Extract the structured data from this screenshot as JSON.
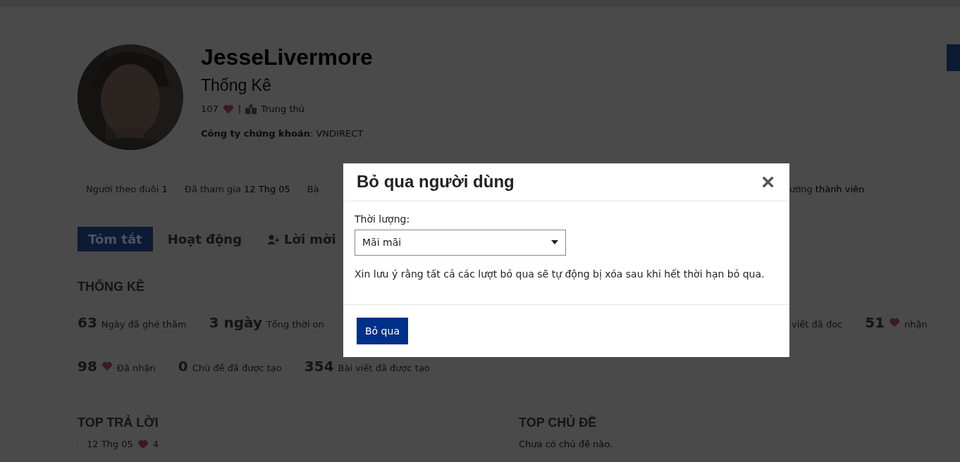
{
  "profile": {
    "name": "JesseLivermore",
    "subtitle": "Thống Kê",
    "reactions": "107",
    "separator": "|",
    "rank": "Trung thủ",
    "broker": "**Công ty chứng khoán**: VNDIRECT"
  },
  "meta": {
    "left": [
      {
        "label": "Người theo đuôi",
        "value": "1"
      },
      {
        "label": "Đã tham gia",
        "value": "12 Thg 05"
      },
      {
        "label": "Bà"
      }
    ],
    "right": [
      {
        "label": "ường",
        "value": "thành viên"
      }
    ]
  },
  "tabs": [
    {
      "label": "Tóm tắt",
      "selected": true,
      "kind": "plain"
    },
    {
      "label": "Hoạt động",
      "selected": false,
      "kind": "plain"
    },
    {
      "label": "Lời mời",
      "selected": false,
      "kind": "invite"
    }
  ],
  "stats": {
    "title": "THỐNG KÊ",
    "rows": [
      {
        "left": [
          {
            "kind": "plain",
            "value": "63",
            "label": "Ngày đã ghé thăm"
          },
          {
            "kind": "plain",
            "value": "3 ngày",
            "label": "Tổng thời on"
          }
        ],
        "right": [
          {
            "kind": "label_only",
            "label": "viết đã đọc"
          },
          {
            "kind": "heart",
            "value": "51",
            "label": "nhận"
          }
        ]
      },
      {
        "left": [
          {
            "kind": "heart",
            "value": "98",
            "label": "Đã nhận"
          },
          {
            "kind": "plain",
            "value": "0",
            "label": "Chủ đề đã được tạo"
          },
          {
            "kind": "plain",
            "value": "354",
            "label": "Bài viết đã được tạo"
          }
        ],
        "right": []
      }
    ]
  },
  "top_replies": {
    "title": "TOP TRẢ LỜI",
    "items": [
      {
        "date": "12 Thg 05",
        "likes": "4"
      }
    ]
  },
  "top_topics": {
    "title": "TOP CHỦ ĐỀ",
    "empty_text": "Chưa có chủ đề nào."
  },
  "dialog": {
    "title": "Bỏ qua người dùng",
    "close": "×",
    "field_label": "Thời lượng:",
    "field_value": "Mãi mãi",
    "note": "Xin lưu ý rằng tất cả các lượt bỏ qua sẽ tự động bị xóa sau khi hết thời hạn bỏ qua.",
    "button": "Bỏ qua"
  }
}
